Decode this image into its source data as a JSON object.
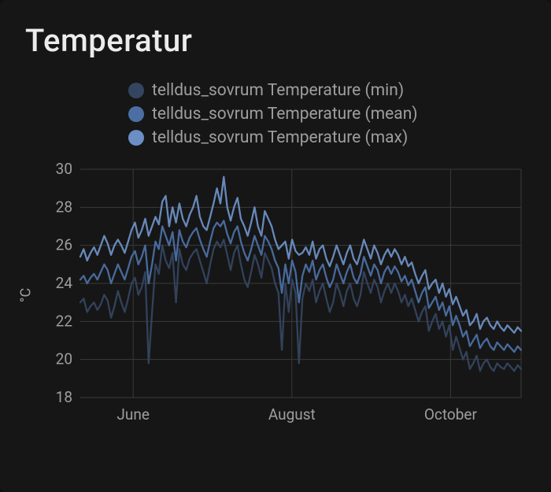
{
  "title": "Temperatur",
  "legend": [
    {
      "label": "telldus_sovrum Temperature (min)",
      "color": "#34455f"
    },
    {
      "label": "telldus_sovrum Temperature (mean)",
      "color": "#4b6fa3"
    },
    {
      "label": "telldus_sovrum Temperature (max)",
      "color": "#6b8fc4"
    }
  ],
  "ylabel": "°C",
  "chart_data": {
    "type": "line",
    "xlabel": "",
    "ylabel": "°C",
    "ylim": [
      18,
      30
    ],
    "x_ticks": [
      "June",
      "August",
      "October"
    ],
    "y_ticks": [
      18,
      20,
      22,
      24,
      26,
      28,
      30
    ],
    "series": [
      {
        "name": "telldus_sovrum Temperature (min)",
        "color": "#34455f",
        "values": [
          23.0,
          23.2,
          22.5,
          22.8,
          23.0,
          22.6,
          22.9,
          23.4,
          23.1,
          22.2,
          22.8,
          23.6,
          23.0,
          22.5,
          23.2,
          24.0,
          24.3,
          23.4,
          23.8,
          24.6,
          19.8,
          22.5,
          25.0,
          24.5,
          26.0,
          25.2,
          24.8,
          25.6,
          23.0,
          25.8,
          25.0,
          24.7,
          25.3,
          25.6,
          25.8,
          25.2,
          24.6,
          24.0,
          25.0,
          25.8,
          26.2,
          25.9,
          26.3,
          25.5,
          24.7,
          25.6,
          26.0,
          25.0,
          24.2,
          23.8,
          24.6,
          25.5,
          25.0,
          24.3,
          25.6,
          25.2,
          24.8,
          24.0,
          23.5,
          20.5,
          24.0,
          22.5,
          24.2,
          23.5,
          19.8,
          23.2,
          24.0,
          23.6,
          24.2,
          23.0,
          23.6,
          24.0,
          23.2,
          22.5,
          23.0,
          24.0,
          23.5,
          22.8,
          23.6,
          24.0,
          23.2,
          22.8,
          23.4,
          24.6,
          24.0,
          23.5,
          24.2,
          23.8,
          23.0,
          23.6,
          24.0,
          23.5,
          24.0,
          23.6,
          23.0,
          23.4,
          22.8,
          23.2,
          22.6,
          22.0,
          22.5,
          22.8,
          21.5,
          22.0,
          22.4,
          21.6,
          22.0,
          21.2,
          21.8,
          20.5,
          21.2,
          20.6,
          20.0,
          20.4,
          19.5,
          19.8,
          20.2,
          19.4,
          19.8,
          20.0,
          19.6,
          19.4,
          19.8,
          19.6,
          19.5,
          19.8,
          19.6,
          19.4,
          19.7,
          19.5
        ]
      },
      {
        "name": "telldus_sovrum Temperature (mean)",
        "color": "#4b6fa3",
        "values": [
          24.2,
          24.4,
          24.0,
          24.3,
          24.5,
          24.2,
          24.6,
          25.0,
          24.7,
          24.0,
          24.5,
          25.0,
          24.6,
          24.2,
          24.8,
          25.4,
          25.7,
          25.0,
          25.4,
          26.0,
          24.0,
          25.0,
          26.2,
          25.8,
          27.0,
          26.5,
          26.0,
          26.7,
          25.2,
          26.8,
          26.2,
          25.9,
          26.4,
          26.7,
          26.9,
          26.3,
          25.8,
          25.4,
          26.2,
          26.9,
          27.2,
          27.0,
          27.3,
          26.6,
          26.1,
          26.7,
          27.0,
          26.2,
          25.6,
          25.2,
          25.8,
          26.5,
          26.0,
          25.5,
          26.5,
          26.2,
          25.8,
          25.2,
          24.8,
          23.5,
          25.0,
          24.0,
          25.2,
          24.6,
          23.0,
          24.4,
          25.0,
          24.6,
          25.2,
          24.2,
          24.7,
          25.0,
          24.3,
          23.8,
          24.2,
          25.0,
          24.5,
          24.0,
          24.6,
          25.0,
          24.3,
          24.0,
          24.5,
          25.4,
          24.9,
          24.4,
          25.0,
          24.7,
          24.0,
          24.6,
          24.9,
          24.5,
          24.9,
          24.6,
          24.1,
          24.4,
          23.9,
          24.2,
          23.6,
          23.0,
          23.5,
          23.8,
          22.7,
          23.0,
          23.3,
          22.6,
          23.0,
          22.3,
          22.8,
          21.8,
          22.3,
          21.8,
          21.2,
          21.5,
          20.7,
          21.0,
          21.3,
          20.6,
          20.9,
          21.1,
          20.7,
          20.5,
          20.9,
          20.7,
          20.5,
          20.8,
          20.6,
          20.4,
          20.7,
          20.5
        ]
      },
      {
        "name": "telldus_sovrum Temperature (max)",
        "color": "#6b8fc4",
        "values": [
          25.4,
          25.8,
          25.2,
          25.6,
          25.9,
          25.5,
          26.0,
          26.5,
          26.1,
          25.5,
          26.0,
          26.3,
          26.0,
          25.6,
          26.2,
          26.8,
          27.2,
          26.4,
          26.8,
          27.4,
          26.5,
          27.0,
          27.5,
          27.1,
          28.3,
          28.6,
          27.0,
          28.0,
          27.2,
          28.2,
          27.4,
          27.0,
          27.6,
          28.0,
          28.6,
          27.5,
          27.0,
          26.8,
          27.5,
          28.2,
          29.0,
          28.2,
          29.6,
          28.0,
          27.3,
          28.0,
          28.5,
          27.4,
          27.0,
          26.5,
          27.2,
          28.0,
          27.0,
          26.5,
          27.8,
          27.4,
          27.0,
          26.3,
          25.8,
          26.0,
          26.2,
          25.3,
          26.3,
          25.7,
          25.5,
          25.6,
          25.9,
          25.5,
          26.2,
          25.3,
          25.8,
          26.0,
          25.3,
          24.9,
          25.4,
          26.0,
          25.5,
          25.0,
          25.6,
          26.0,
          25.3,
          25.0,
          25.6,
          26.3,
          25.8,
          25.3,
          26.0,
          25.6,
          25.0,
          25.5,
          25.8,
          25.4,
          25.8,
          25.5,
          25.0,
          25.4,
          24.9,
          25.1,
          24.5,
          24.0,
          24.4,
          24.7,
          23.7,
          24.0,
          24.2,
          23.5,
          24.0,
          23.3,
          23.7,
          22.9,
          23.3,
          22.8,
          22.3,
          22.6,
          21.8,
          22.0,
          22.4,
          21.6,
          22.0,
          22.2,
          21.8,
          21.6,
          22.0,
          21.7,
          21.5,
          21.8,
          21.6,
          21.4,
          21.7,
          21.5
        ]
      }
    ]
  }
}
